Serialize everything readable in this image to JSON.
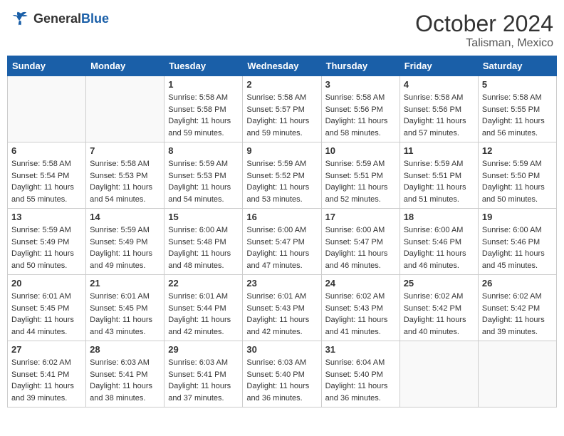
{
  "header": {
    "logo": {
      "general": "General",
      "blue": "Blue"
    },
    "title": "October 2024",
    "subtitle": "Talisman, Mexico"
  },
  "calendar": {
    "weekdays": [
      "Sunday",
      "Monday",
      "Tuesday",
      "Wednesday",
      "Thursday",
      "Friday",
      "Saturday"
    ],
    "weeks": [
      [
        {
          "day": "",
          "info": ""
        },
        {
          "day": "",
          "info": ""
        },
        {
          "day": "1",
          "info": "Sunrise: 5:58 AM\nSunset: 5:58 PM\nDaylight: 11 hours and 59 minutes."
        },
        {
          "day": "2",
          "info": "Sunrise: 5:58 AM\nSunset: 5:57 PM\nDaylight: 11 hours and 59 minutes."
        },
        {
          "day": "3",
          "info": "Sunrise: 5:58 AM\nSunset: 5:56 PM\nDaylight: 11 hours and 58 minutes."
        },
        {
          "day": "4",
          "info": "Sunrise: 5:58 AM\nSunset: 5:56 PM\nDaylight: 11 hours and 57 minutes."
        },
        {
          "day": "5",
          "info": "Sunrise: 5:58 AM\nSunset: 5:55 PM\nDaylight: 11 hours and 56 minutes."
        }
      ],
      [
        {
          "day": "6",
          "info": "Sunrise: 5:58 AM\nSunset: 5:54 PM\nDaylight: 11 hours and 55 minutes."
        },
        {
          "day": "7",
          "info": "Sunrise: 5:58 AM\nSunset: 5:53 PM\nDaylight: 11 hours and 54 minutes."
        },
        {
          "day": "8",
          "info": "Sunrise: 5:59 AM\nSunset: 5:53 PM\nDaylight: 11 hours and 54 minutes."
        },
        {
          "day": "9",
          "info": "Sunrise: 5:59 AM\nSunset: 5:52 PM\nDaylight: 11 hours and 53 minutes."
        },
        {
          "day": "10",
          "info": "Sunrise: 5:59 AM\nSunset: 5:51 PM\nDaylight: 11 hours and 52 minutes."
        },
        {
          "day": "11",
          "info": "Sunrise: 5:59 AM\nSunset: 5:51 PM\nDaylight: 11 hours and 51 minutes."
        },
        {
          "day": "12",
          "info": "Sunrise: 5:59 AM\nSunset: 5:50 PM\nDaylight: 11 hours and 50 minutes."
        }
      ],
      [
        {
          "day": "13",
          "info": "Sunrise: 5:59 AM\nSunset: 5:49 PM\nDaylight: 11 hours and 50 minutes."
        },
        {
          "day": "14",
          "info": "Sunrise: 5:59 AM\nSunset: 5:49 PM\nDaylight: 11 hours and 49 minutes."
        },
        {
          "day": "15",
          "info": "Sunrise: 6:00 AM\nSunset: 5:48 PM\nDaylight: 11 hours and 48 minutes."
        },
        {
          "day": "16",
          "info": "Sunrise: 6:00 AM\nSunset: 5:47 PM\nDaylight: 11 hours and 47 minutes."
        },
        {
          "day": "17",
          "info": "Sunrise: 6:00 AM\nSunset: 5:47 PM\nDaylight: 11 hours and 46 minutes."
        },
        {
          "day": "18",
          "info": "Sunrise: 6:00 AM\nSunset: 5:46 PM\nDaylight: 11 hours and 46 minutes."
        },
        {
          "day": "19",
          "info": "Sunrise: 6:00 AM\nSunset: 5:46 PM\nDaylight: 11 hours and 45 minutes."
        }
      ],
      [
        {
          "day": "20",
          "info": "Sunrise: 6:01 AM\nSunset: 5:45 PM\nDaylight: 11 hours and 44 minutes."
        },
        {
          "day": "21",
          "info": "Sunrise: 6:01 AM\nSunset: 5:45 PM\nDaylight: 11 hours and 43 minutes."
        },
        {
          "day": "22",
          "info": "Sunrise: 6:01 AM\nSunset: 5:44 PM\nDaylight: 11 hours and 42 minutes."
        },
        {
          "day": "23",
          "info": "Sunrise: 6:01 AM\nSunset: 5:43 PM\nDaylight: 11 hours and 42 minutes."
        },
        {
          "day": "24",
          "info": "Sunrise: 6:02 AM\nSunset: 5:43 PM\nDaylight: 11 hours and 41 minutes."
        },
        {
          "day": "25",
          "info": "Sunrise: 6:02 AM\nSunset: 5:42 PM\nDaylight: 11 hours and 40 minutes."
        },
        {
          "day": "26",
          "info": "Sunrise: 6:02 AM\nSunset: 5:42 PM\nDaylight: 11 hours and 39 minutes."
        }
      ],
      [
        {
          "day": "27",
          "info": "Sunrise: 6:02 AM\nSunset: 5:41 PM\nDaylight: 11 hours and 39 minutes."
        },
        {
          "day": "28",
          "info": "Sunrise: 6:03 AM\nSunset: 5:41 PM\nDaylight: 11 hours and 38 minutes."
        },
        {
          "day": "29",
          "info": "Sunrise: 6:03 AM\nSunset: 5:41 PM\nDaylight: 11 hours and 37 minutes."
        },
        {
          "day": "30",
          "info": "Sunrise: 6:03 AM\nSunset: 5:40 PM\nDaylight: 11 hours and 36 minutes."
        },
        {
          "day": "31",
          "info": "Sunrise: 6:04 AM\nSunset: 5:40 PM\nDaylight: 11 hours and 36 minutes."
        },
        {
          "day": "",
          "info": ""
        },
        {
          "day": "",
          "info": ""
        }
      ]
    ]
  }
}
